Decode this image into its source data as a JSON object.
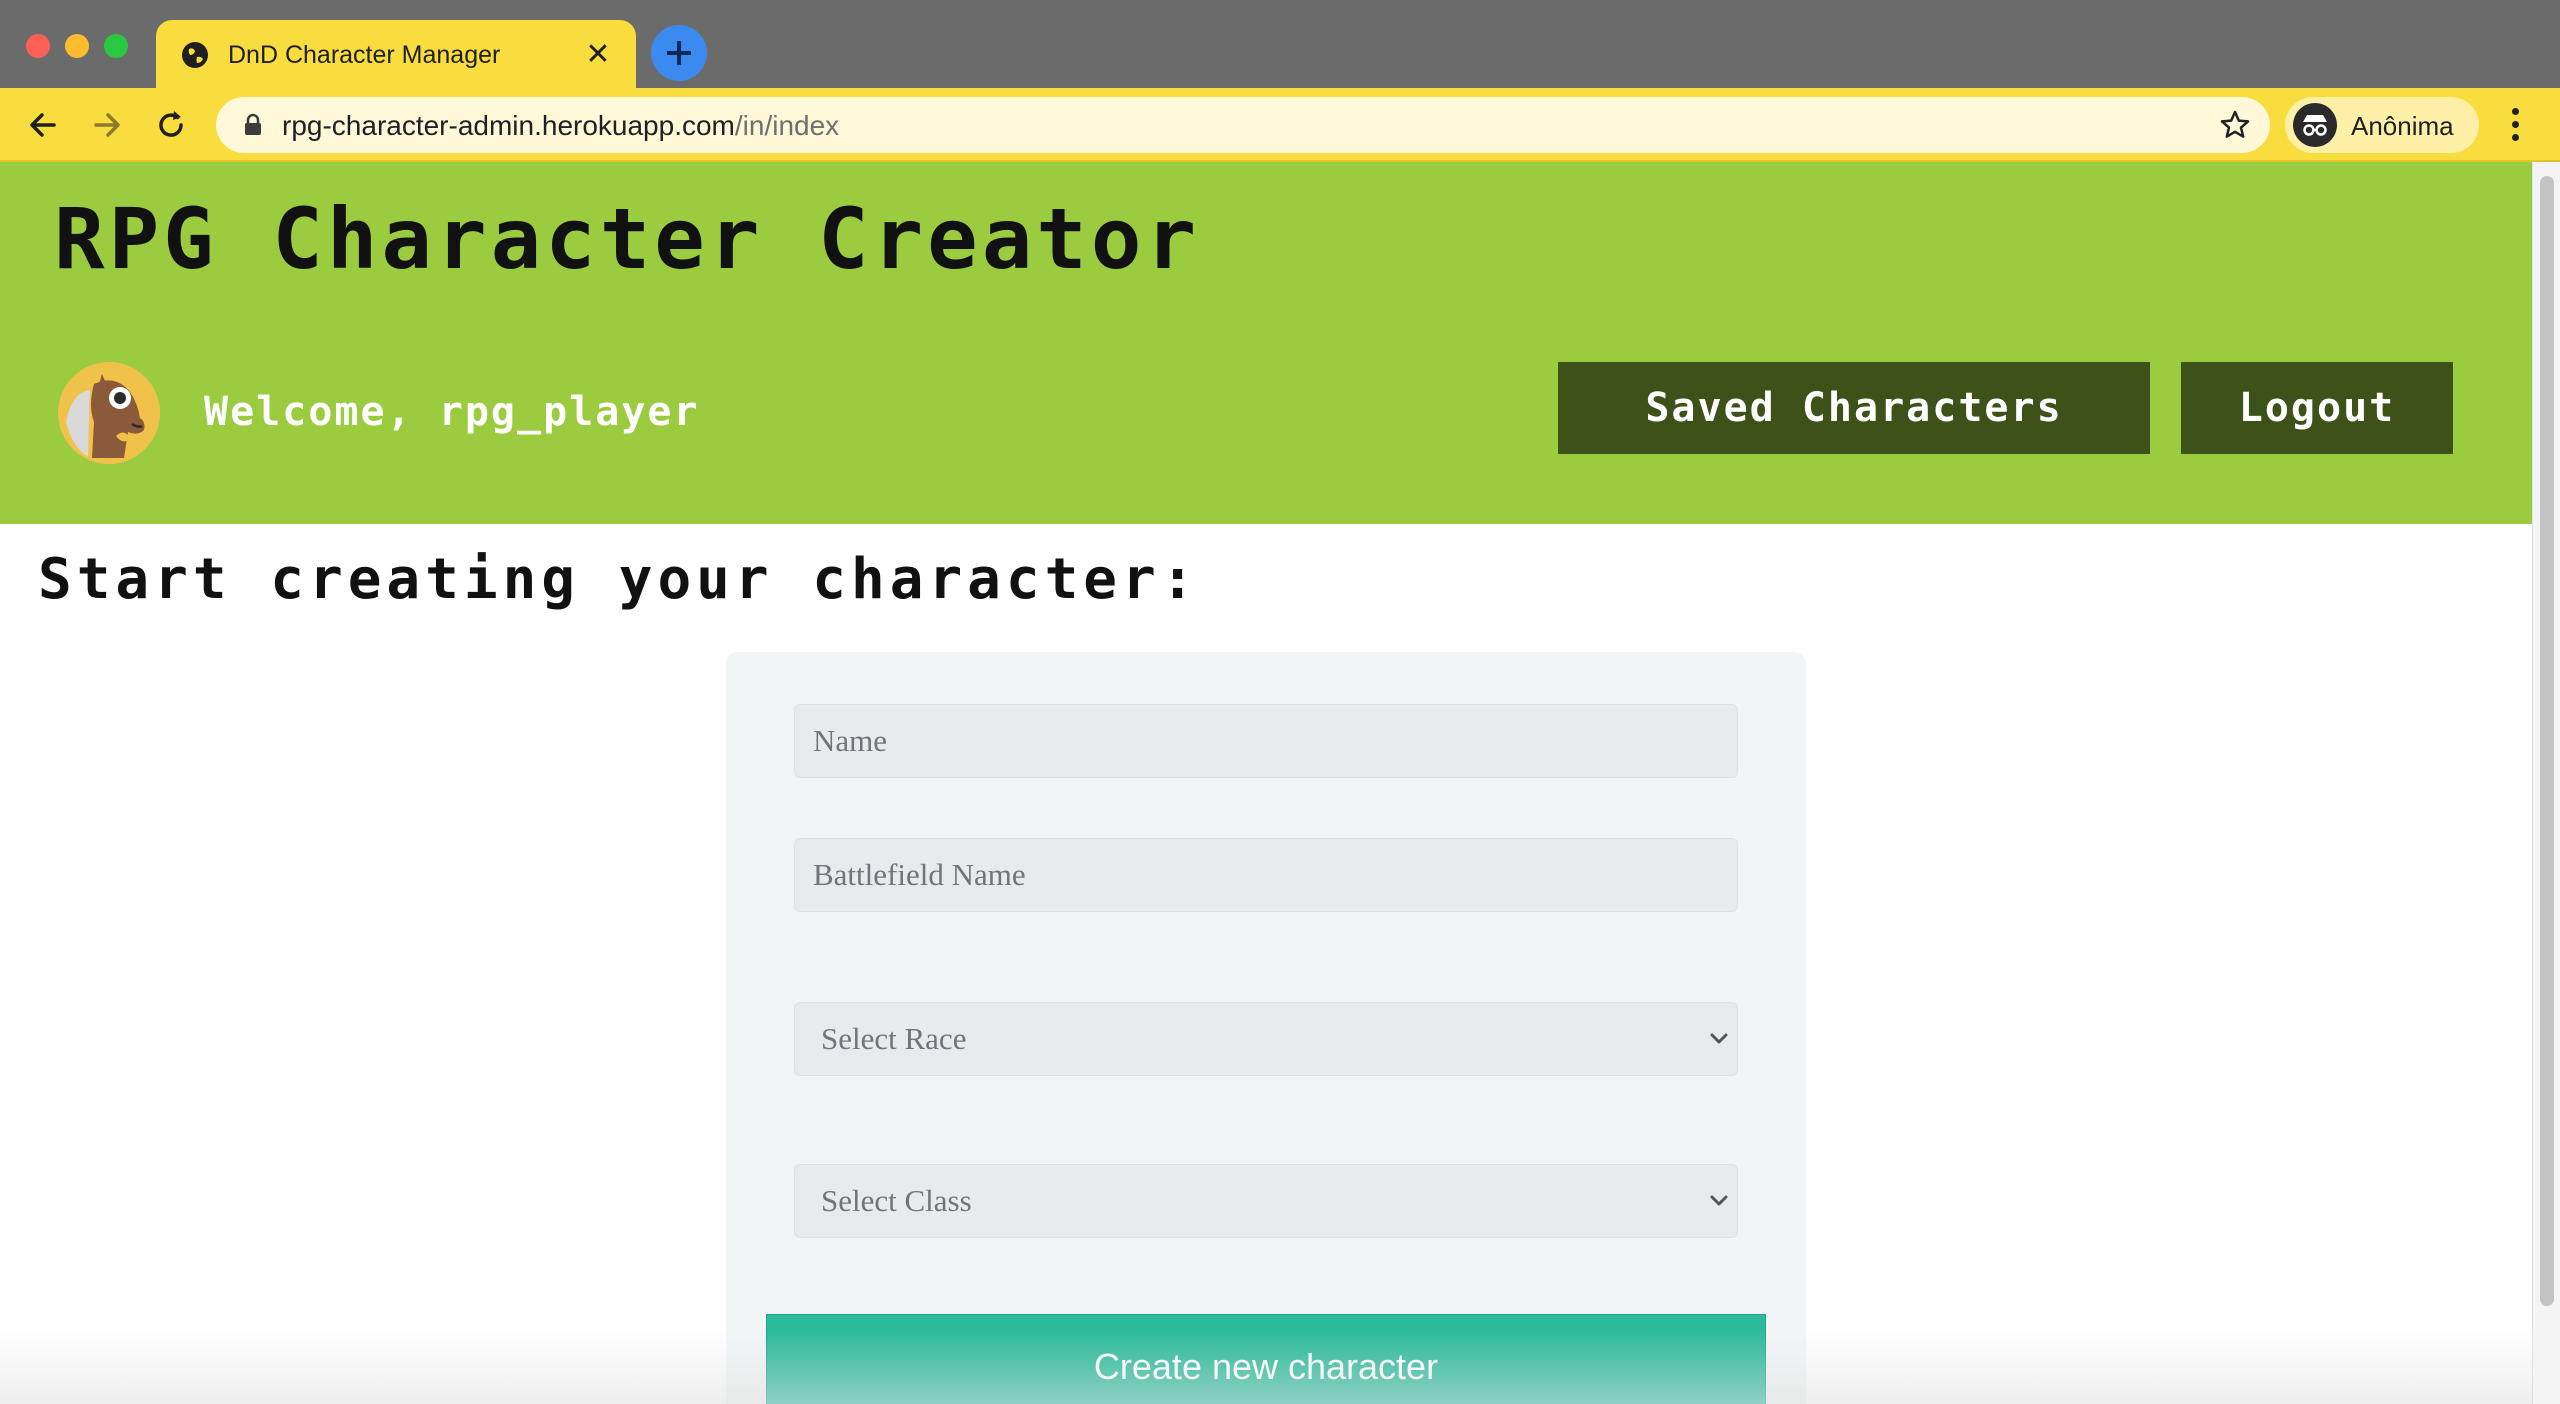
{
  "browser": {
    "tab_title": "DnD Character Manager",
    "url_host": "rpg-character-admin.herokuapp.com",
    "url_path": "/in/index",
    "profile_label": "Anônima"
  },
  "header": {
    "title": "RPG Character Creator",
    "welcome": "Welcome, rpg_player",
    "saved_button": "Saved Characters",
    "logout_button": "Logout"
  },
  "main": {
    "heading": "Start creating your character:"
  },
  "form": {
    "name_placeholder": "Name",
    "battlefield_placeholder": "Battlefield Name",
    "race_select": "Select Race",
    "class_select": "Select Class",
    "submit": "Create new character"
  },
  "colors": {
    "header_bg": "#9bcc40",
    "header_button": "#3d5219",
    "submit_button": "#2bbb9b",
    "browser_accent": "#f9dc3d"
  },
  "icons": {
    "tab_icon": "globe-icon",
    "new_tab": "plus-icon",
    "back": "arrow-left-icon",
    "forward": "arrow-right-icon",
    "reload": "reload-icon",
    "secure": "lock-icon",
    "bookmark": "star-icon",
    "profile": "incognito-icon",
    "menu": "kebab-menu-icon",
    "avatar": "horse-avatar-icon"
  }
}
